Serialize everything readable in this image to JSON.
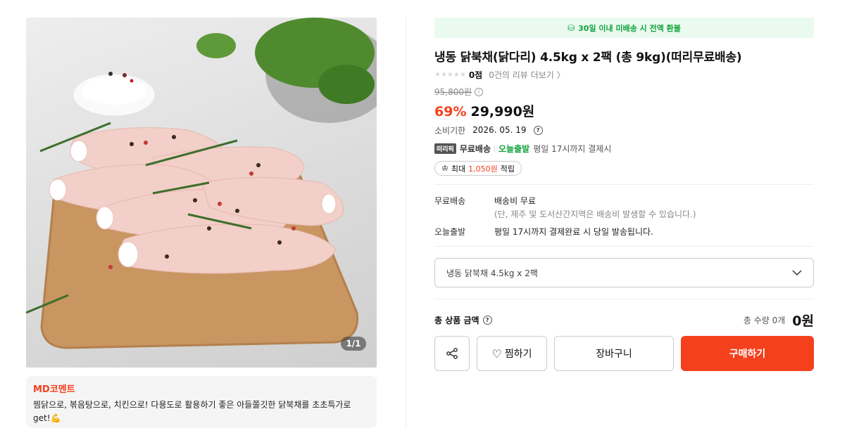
{
  "product": {
    "image_counter": "1/1",
    "md_comment": {
      "title": "MD코멘트",
      "text": "찜닭으로, 볶음탕으로, 치킨으로! 다용도로 활용하기 좋은 아들쫄깃한 닭북채를 초초특가로 get!💪"
    },
    "banner": "30일 이내 미배송 시 전액 환불",
    "title": "냉동 닭북채(닭다리) 4.5kg x 2팩 (총 9kg)(떠리무료배송)",
    "rating": {
      "stars": "★★★★★",
      "score": "0점",
      "review_link": "0건의 리뷰 더보기 〉"
    },
    "original_price": "95,800원",
    "discount": "69%",
    "sale_price": "29,990원",
    "expiry": {
      "label": "소비기한",
      "value": "2026. 05. 19"
    },
    "shipping_line": {
      "badge": "떠리픽",
      "free": "무료배송",
      "today": "오늘출발",
      "condition": "평일 17시까지 결제시"
    },
    "points": {
      "prefix": "최대",
      "amount": "1,050원",
      "suffix": "적립"
    },
    "details": [
      {
        "key": "무료배송",
        "value": "배송비 무료",
        "sub": "(단, 제주 및 도서산간지역은 배송비 발생할 수 있습니다.)"
      },
      {
        "key": "오늘출발",
        "value": "평일 17시까지 결제완료 시 당일 발송됩니다."
      }
    ],
    "option_select": "냉동 닭북채 4.5kg x 2팩",
    "total": {
      "label": "총 상품 금액",
      "qty": "총 수량 0개",
      "sum": "0원"
    },
    "buttons": {
      "wish": "찜하기",
      "cart": "장바구니",
      "buy": "구매하기"
    },
    "colors": {
      "accent": "#f5401d",
      "green": "#14a33f"
    }
  }
}
